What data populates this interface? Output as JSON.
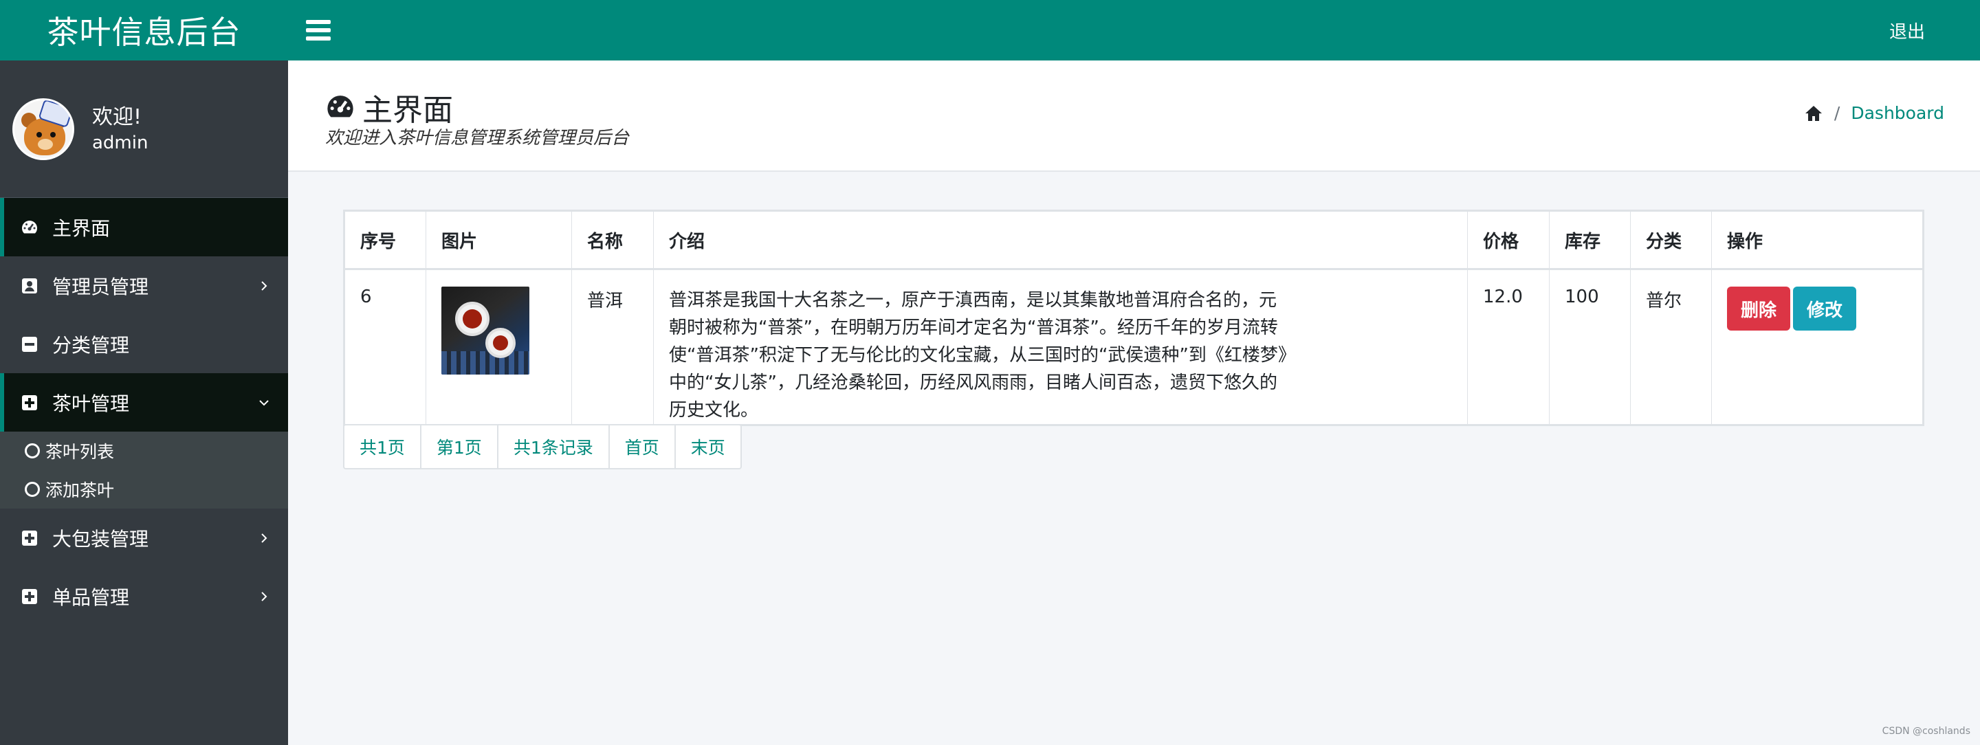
{
  "brand": {
    "title": "茶叶信息后台"
  },
  "user": {
    "welcome": "欢迎!",
    "name": "admin"
  },
  "sidebar": {
    "items": [
      {
        "label": "主界面",
        "icon": "dashboard-icon",
        "active": true
      },
      {
        "label": "管理员管理",
        "icon": "user-box-icon",
        "caret": "chevron-right"
      },
      {
        "label": "分类管理",
        "icon": "minus-square-icon"
      },
      {
        "label": "茶叶管理",
        "icon": "plus-square-icon",
        "caret": "chevron-down",
        "open": true,
        "children": [
          {
            "label": "茶叶列表"
          },
          {
            "label": "添加茶叶"
          }
        ]
      },
      {
        "label": "大包装管理",
        "icon": "plus-square-icon",
        "caret": "chevron-right"
      },
      {
        "label": "单品管理",
        "icon": "plus-square-icon",
        "caret": "chevron-right"
      }
    ]
  },
  "topbar": {
    "logout_label": "退出"
  },
  "header": {
    "title": "主界面",
    "subtitle": "欢迎进入茶叶信息管理系统管理员后台",
    "breadcrumb": {
      "separator": "/",
      "current": "Dashboard"
    }
  },
  "table": {
    "columns": [
      "序号",
      "图片",
      "名称",
      "介绍",
      "价格",
      "库存",
      "分类",
      "操作"
    ],
    "rows": [
      {
        "id": "6",
        "name": "普洱",
        "desc": "普洱茶是我国十大名茶之一，原产于滇西南，是以其集散地普洱府合名的，元朝时被称为“普茶”，在明朝万历年间才定名为“普洱茶”。经历千年的岁月流转使“普洱茶”积淀下了无与伦比的文化宝藏，从三国时的“武侯遗种”到《红楼梦》中的“女儿茶”，几经沧桑轮回，历经风风雨雨，目睹人间百态，遗贸下悠久的历史文化。",
        "price": "12.0",
        "stock": "100",
        "category": "普尔",
        "actions": {
          "delete": "删除",
          "edit": "修改"
        }
      }
    ]
  },
  "pagination": [
    "共1页",
    "第1页",
    "共1条记录",
    "首页",
    "末页"
  ],
  "watermark": "CSDN @coshlands",
  "colors": {
    "accent": "#00897b",
    "sidebar": "#343a40",
    "danger": "#dc3545",
    "info": "#17a2b8"
  }
}
